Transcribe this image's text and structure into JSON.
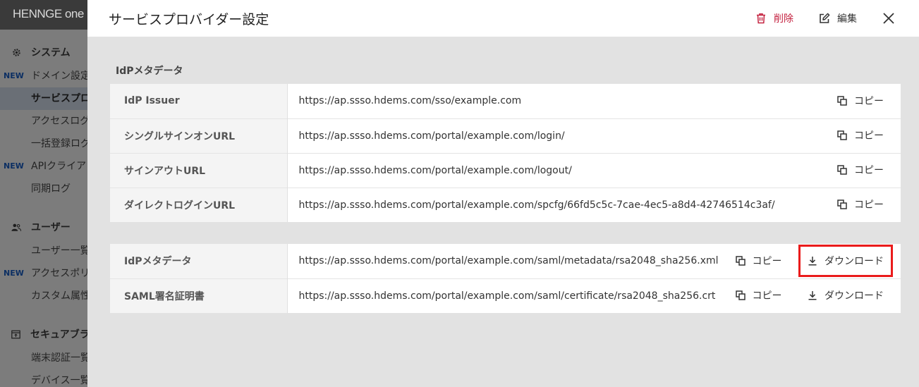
{
  "sidebar": {
    "brand": "HENNGE one",
    "new_badge": "NEW",
    "sections": [
      {
        "label": "システム",
        "icon": "gear-icon",
        "items": [
          {
            "label": "ドメイン設定",
            "new": true,
            "active": false
          },
          {
            "label": "サービスプロ",
            "new": false,
            "active": true
          },
          {
            "label": "アクセスログ",
            "new": false,
            "active": false
          },
          {
            "label": "一括登録ログ",
            "new": false,
            "active": false
          },
          {
            "label": "APIクライア",
            "new": true,
            "active": false
          },
          {
            "label": "同期ログ",
            "new": false,
            "active": false
          }
        ]
      },
      {
        "label": "ユーザー",
        "icon": "users-icon",
        "items": [
          {
            "label": "ユーザー一覧",
            "new": false,
            "active": false
          },
          {
            "label": "アクセスポリ",
            "new": true,
            "active": false
          },
          {
            "label": "カスタム属性",
            "new": false,
            "active": false
          }
        ]
      },
      {
        "label": "セキュアブラ",
        "icon": "browser-icon",
        "items": [
          {
            "label": "端末認証一覧",
            "new": false,
            "active": false
          },
          {
            "label": "デバイス一覧",
            "new": false,
            "active": false
          }
        ]
      }
    ]
  },
  "modal": {
    "title": "サービスプロバイダー設定",
    "delete_label": "削除",
    "edit_label": "編集",
    "section_label": "IdPメタデータ",
    "copy_label": "コピー",
    "download_label": "ダウンロード",
    "accent_color": "#c4213f",
    "highlight_color": "#ea1b1b",
    "table1": [
      {
        "key": "IdP Issuer",
        "value": "https://ap.ssso.hdems.com/sso/example.com"
      },
      {
        "key": "シングルサインオンURL",
        "value": "https://ap.ssso.hdems.com/portal/example.com/login/"
      },
      {
        "key": "サインアウトURL",
        "value": "https://ap.ssso.hdems.com/portal/example.com/logout/"
      },
      {
        "key": "ダイレクトログインURL",
        "value": "https://ap.ssso.hdems.com/portal/example.com/spcfg/66fd5c5c-7cae-4ec5-a8d4-42746514c3af/"
      }
    ],
    "table2": [
      {
        "key": "IdPメタデータ",
        "value": "https://ap.ssso.hdems.com/portal/example.com/saml/metadata/rsa2048_sha256.xml",
        "highlight_download": true
      },
      {
        "key": "SAML署名証明書",
        "value": "https://ap.ssso.hdems.com/portal/example.com/saml/certificate/rsa2048_sha256.crt",
        "highlight_download": false
      }
    ]
  }
}
